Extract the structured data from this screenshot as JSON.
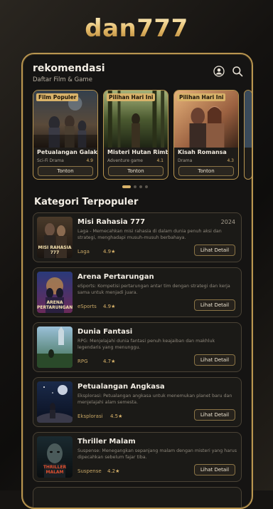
{
  "brand": "dan777",
  "header": {
    "title": "rekomendasi",
    "subtitle": "Daftar Film & Game"
  },
  "carousel": [
    {
      "tag": "Film Populer",
      "title": "Petualangan Galaksi",
      "genre": "Sci-Fi Drama",
      "rating": "4.9",
      "button": "Tonton"
    },
    {
      "tag": "Pilihan Hari Ini",
      "title": "Misteri Hutan Rimba",
      "genre": "Adventure game",
      "rating": "4.1",
      "button": "Tonton"
    },
    {
      "tag": "Pilihan Hari Ini",
      "title": "Kisah Romansa",
      "genre": "Drama",
      "rating": "4.3",
      "button": "Tonton"
    }
  ],
  "section_title": "Kategori Terpopuler",
  "items": [
    {
      "title": "Misi Rahasia 777",
      "year": "2024",
      "desc": "Laga - Memecahkan misi rahasia di dalam dunia penuh aksi dan strategi, menghadapi musuh-musuh berbahaya.",
      "genre": "Laga",
      "rating": "4.9★",
      "button": "Lihat Detail",
      "thumb_label": "MISI RAHASIA 777"
    },
    {
      "title": "Arena Pertarungan",
      "year": "",
      "desc": "eSports: Kompetisi pertarungan antar tim dengan strategi dan kerja sama untuk menjadi juara.",
      "genre": "eSports",
      "rating": "4.9★",
      "button": "Lihat Detail",
      "thumb_label": "ARENA PERTARUNGAN"
    },
    {
      "title": "Dunia Fantasi",
      "year": "",
      "desc": "RPG: Menjelajahi dunia fantasi penuh keajaiban dan makhluk legendaris yang menunggu.",
      "genre": "RPG",
      "rating": "4.7★",
      "button": "Lihat Detail",
      "thumb_label": ""
    },
    {
      "title": "Petualangan Angkasa",
      "year": "",
      "desc": "Eksplorasi: Petualangan angkasa untuk menemukan planet baru dan menjelajahi alam semesta.",
      "genre": "Eksplorasi",
      "rating": "4.5★",
      "button": "Lihat Detail",
      "thumb_label": ""
    },
    {
      "title": "Thriller Malam",
      "year": "",
      "desc": "Suspense: Menegangkan sepanjang malam dengan misteri yang harus dipecahkan sebelum fajar tiba.",
      "genre": "Suspense",
      "rating": "4.2★",
      "button": "Lihat Detail",
      "thumb_label": "THRILLER MALAM"
    }
  ],
  "colors": {
    "accent": "#d9b36a",
    "border": "#b89550",
    "bg": "#151413"
  },
  "icons": {
    "profile": "user-circle-icon",
    "search": "search-icon"
  }
}
